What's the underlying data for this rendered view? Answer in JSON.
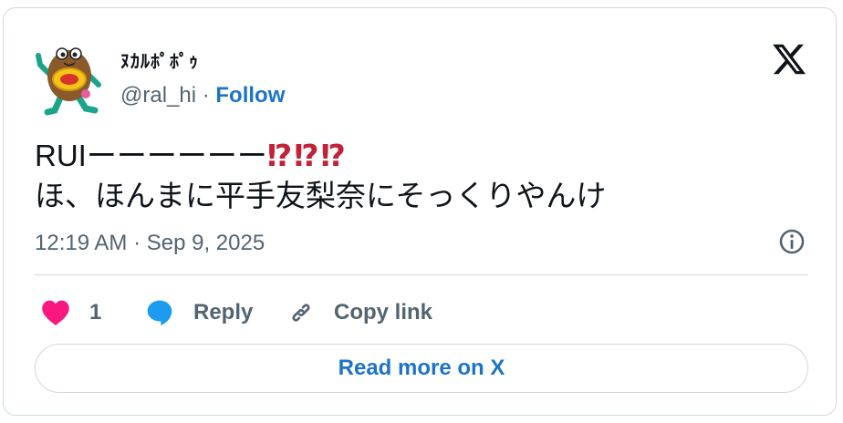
{
  "author": {
    "display_name": "ﾇｶﾙﾎﾟﾎﾟｩ",
    "handle": "@ral_hi",
    "separator": " · ",
    "follow_label": "Follow"
  },
  "tweet": {
    "line1_text": "RUIーーーーーー",
    "line1_emoji": "⁉⁉⁉",
    "line2_text": "ほ、ほんまに平手友梨奈にそっくりやんけ"
  },
  "timestamp": "12:19 AM · Sep 9, 2025",
  "actions": {
    "like_count": "1",
    "reply_label": "Reply",
    "copy_link_label": "Copy link"
  },
  "read_more_label": "Read more on X",
  "colors": {
    "link_blue": "#1d74c7",
    "like_pink": "#f91880",
    "reply_blue": "#1d9bf0",
    "muted_gray": "#536471",
    "border": "#cfd9de",
    "emoji_red": "#c2213a"
  },
  "icons": {
    "brand": "x-logo-icon",
    "info": "info-icon",
    "like": "heart-icon",
    "reply": "speech-bubble-icon",
    "copy": "link-icon",
    "avatar": "kiwi-mascot-avatar"
  }
}
